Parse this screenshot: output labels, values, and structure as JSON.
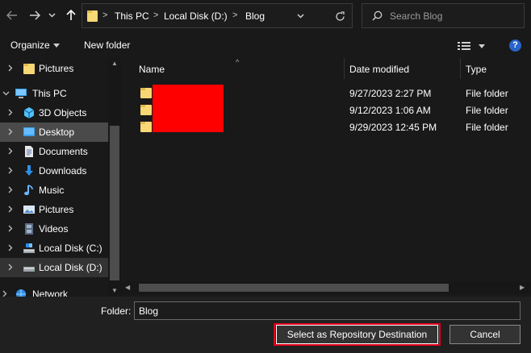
{
  "address_bar": {
    "breadcrumbs": [
      "This PC",
      "Local Disk  (D:)",
      "Blog"
    ]
  },
  "search": {
    "placeholder": "Search Blog"
  },
  "toolbar": {
    "organize_label": "Organize",
    "new_folder_label": "New folder",
    "help_label": "?"
  },
  "nav_pane": {
    "items": [
      {
        "label": "Pictures",
        "icon": "folder-icon",
        "level": 1
      },
      {
        "label": "This PC",
        "icon": "computer-icon",
        "level": 0,
        "expanded": true
      },
      {
        "label": "3D Objects",
        "icon": "cube-icon",
        "level": 1
      },
      {
        "label": "Desktop",
        "icon": "desktop-icon",
        "level": 1,
        "selected": true
      },
      {
        "label": "Documents",
        "icon": "document-icon",
        "level": 1
      },
      {
        "label": "Downloads",
        "icon": "download-arrow-icon",
        "level": 1
      },
      {
        "label": "Music",
        "icon": "music-note-icon",
        "level": 1
      },
      {
        "label": "Pictures",
        "icon": "picture-icon",
        "level": 1
      },
      {
        "label": "Videos",
        "icon": "film-icon",
        "level": 1
      },
      {
        "label": "Local Disk (C:)",
        "icon": "drive-icon",
        "level": 1
      },
      {
        "label": "Local Disk  (D:)",
        "icon": "drive-icon",
        "level": 1,
        "hovered": true
      },
      {
        "label": "Network",
        "icon": "network-icon",
        "level": 0
      }
    ]
  },
  "file_list": {
    "columns": [
      "Name",
      "Date modified",
      "Type"
    ],
    "rows": [
      {
        "name": "",
        "date_modified": "9/27/2023 2:27 PM",
        "type": "File folder"
      },
      {
        "name": "",
        "date_modified": "9/12/2023 1:06 AM",
        "type": "File folder"
      },
      {
        "name": "",
        "date_modified": "9/29/2023 12:45 PM",
        "type": "File folder"
      }
    ],
    "names_redacted": true,
    "redaction_color": "#ff0000"
  },
  "footer": {
    "folder_label": "Folder:",
    "folder_value": "Blog",
    "select_button_label": "Select as Repository Destination",
    "cancel_button_label": "Cancel"
  },
  "colors": {
    "background": "#191919",
    "footer_background": "#202020",
    "selection": "#4a4a4a",
    "highlight_outline": "#e0001b",
    "folder_yellow": "#f8d775",
    "help_blue": "#2a63c9"
  }
}
